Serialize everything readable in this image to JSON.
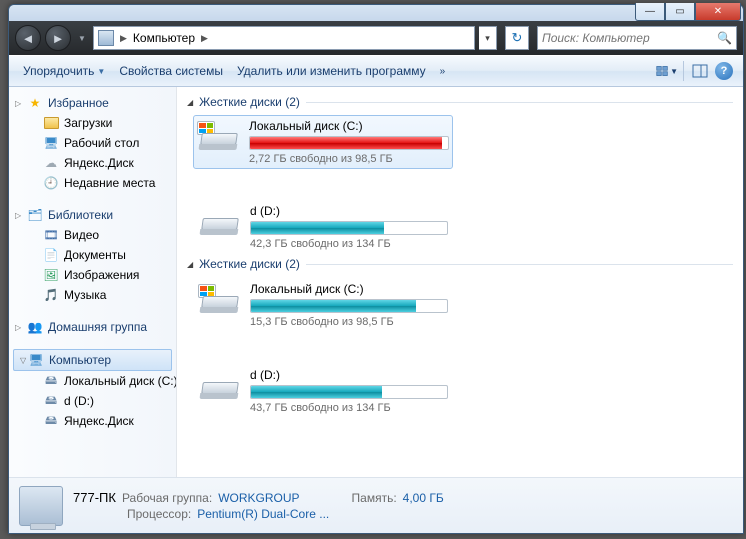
{
  "titlebar": {
    "min": "—",
    "max": "▭",
    "close": "✕"
  },
  "nav": {
    "crumb_root": "Компьютер",
    "search_placeholder": "Поиск: Компьютер"
  },
  "toolbar": {
    "organize": "Упорядочить",
    "sys_props": "Свойства системы",
    "uninstall": "Удалить или изменить программу",
    "overflow": "»"
  },
  "sidebar": {
    "favorites": {
      "label": "Избранное",
      "items": [
        "Загрузки",
        "Рабочий стол",
        "Яндекс.Диск",
        "Недавние места"
      ]
    },
    "libraries": {
      "label": "Библиотеки",
      "items": [
        "Видео",
        "Документы",
        "Изображения",
        "Музыка"
      ]
    },
    "homegroup": {
      "label": "Домашняя группа"
    },
    "computer": {
      "label": "Компьютер",
      "items": [
        "Локальный диск (C:)",
        "d (D:)",
        "Яндекс.Диск"
      ]
    }
  },
  "content": {
    "groups": [
      {
        "title": "Жесткие диски (2)",
        "drives": [
          {
            "name": "Локальный диск (C:)",
            "stat": "2,72 ГБ свободно из 98,5 ГБ",
            "fill_pct": 97,
            "color": "red",
            "selected": true,
            "winlogo": true
          },
          {
            "name": "d (D:)",
            "stat": "42,3 ГБ свободно из 134 ГБ",
            "fill_pct": 68,
            "color": "teal",
            "selected": false,
            "winlogo": false
          }
        ]
      },
      {
        "title": "Жесткие диски (2)",
        "drives": [
          {
            "name": "Локальный диск (C:)",
            "stat": "15,3 ГБ свободно из 98,5 ГБ",
            "fill_pct": 84,
            "color": "teal",
            "selected": false,
            "winlogo": true
          },
          {
            "name": "d (D:)",
            "stat": "43,7 ГБ свободно из 134 ГБ",
            "fill_pct": 67,
            "color": "teal",
            "selected": false,
            "winlogo": false
          }
        ]
      }
    ]
  },
  "details": {
    "pc_name": "777-ПК",
    "workgroup_label": "Рабочая группа:",
    "workgroup_value": "WORKGROUP",
    "memory_label": "Память:",
    "memory_value": "4,00 ГБ",
    "cpu_label": "Процессор:",
    "cpu_value": "Pentium(R) Dual-Core  ..."
  }
}
